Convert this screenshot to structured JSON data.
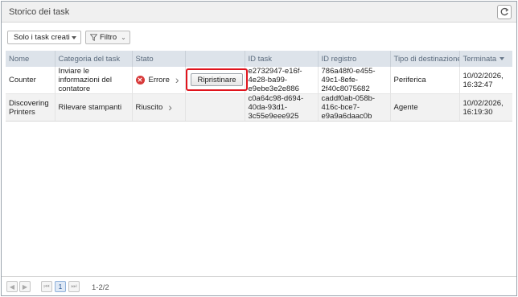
{
  "header": {
    "title": "Storico dei task"
  },
  "toolbar": {
    "scope_select": "Solo i task creati",
    "filter_label": "Filtro"
  },
  "table": {
    "columns": [
      "Nome",
      "Categoria del task",
      "Stato",
      "",
      "ID task",
      "ID registro",
      "Tipo di destinazione",
      "Terminata"
    ],
    "rows": [
      {
        "nome": "Counter",
        "categoria": "Inviare le informazioni del contatore",
        "stato": "Errore",
        "action": "Ripristinare",
        "id_task": "e2732947-e16f-4e28-ba99-e9ebe3e2e886",
        "id_registro": "786a48f0-e455-49c1-8efe-2f40c8075682",
        "tipo": "Periferica",
        "terminata": "10/02/2026, 16:32:47"
      },
      {
        "nome": "Discovering Printers",
        "categoria": "Rilevare stampanti",
        "stato": "Riuscito",
        "action": "",
        "id_task": "c0a64c98-d694-40da-93d1-3c55e9eee925",
        "id_registro": "caddf0ab-058b-416c-bce7-e9a9a6daac0b",
        "tipo": "Agente",
        "terminata": "10/02/2026, 16:19:30"
      }
    ]
  },
  "pager": {
    "current_page": "1",
    "info": "1-2/2"
  }
}
